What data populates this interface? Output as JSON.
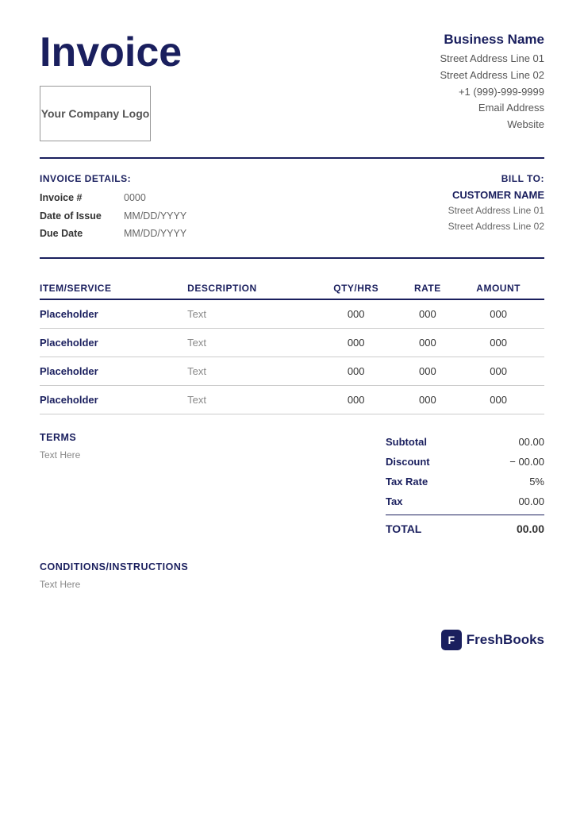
{
  "header": {
    "title": "Invoice",
    "logo_text": "Your Company Logo",
    "business_name": "Business Name",
    "address_line1": "Street Address Line 01",
    "address_line2": "Street Address Line 02",
    "phone": "+1 (999)-999-9999",
    "email": "Email Address",
    "website": "Website"
  },
  "invoice_details": {
    "section_label": "INVOICE DETAILS:",
    "invoice_number_label": "Invoice #",
    "invoice_number_value": "0000",
    "date_of_issue_label": "Date of Issue",
    "date_of_issue_value": "MM/DD/YYYY",
    "due_date_label": "Due Date",
    "due_date_value": "MM/DD/YYYY"
  },
  "bill_to": {
    "section_label": "BILL TO:",
    "customer_name": "CUSTOMER NAME",
    "address_line1": "Street Address Line 01",
    "address_line2": "Street Address Line 02"
  },
  "table": {
    "columns": {
      "item": "ITEM/SERVICE",
      "description": "DESCRIPTION",
      "qty": "QTY/HRS",
      "rate": "RATE",
      "amount": "AMOUNT"
    },
    "rows": [
      {
        "item": "Placeholder",
        "description": "Text",
        "qty": "000",
        "rate": "000",
        "amount": "000"
      },
      {
        "item": "Placeholder",
        "description": "Text",
        "qty": "000",
        "rate": "000",
        "amount": "000"
      },
      {
        "item": "Placeholder",
        "description": "Text",
        "qty": "000",
        "rate": "000",
        "amount": "000"
      },
      {
        "item": "Placeholder",
        "description": "Text",
        "qty": "000",
        "rate": "000",
        "amount": "000"
      }
    ]
  },
  "terms": {
    "label": "TERMS",
    "text": "Text Here"
  },
  "totals": {
    "subtotal_label": "Subtotal",
    "subtotal_value": "00.00",
    "discount_label": "Discount",
    "discount_value": "− 00.00",
    "tax_rate_label": "Tax Rate",
    "tax_rate_value": "5%",
    "tax_label": "Tax",
    "tax_value": "00.00",
    "total_label": "TOTAL",
    "total_value": "00.00"
  },
  "conditions": {
    "label": "CONDITIONS/INSTRUCTIONS",
    "text": "Text Here"
  },
  "branding": {
    "icon_letter": "F",
    "name": "FreshBooks"
  }
}
